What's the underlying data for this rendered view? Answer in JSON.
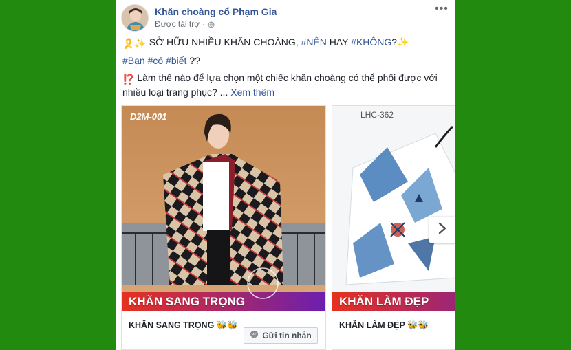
{
  "post": {
    "page_name": "Khăn choàng cổ Phạm Gia",
    "sponsored_label": "Được tài trợ",
    "separator": "·",
    "more_label": "•••",
    "text": {
      "line1_emoji": "🎗️✨",
      "line1_prefix": "SỞ HỮU NHIỀU KHĂN CHOÀNG,",
      "line1_hash1": "#NÊN",
      "line1_mid": "HAY",
      "line1_hash2": "#KHÔNG",
      "line1_suffix": "?✨",
      "line2_hash1": "#Bạn",
      "line2_hash2": "#có",
      "line2_hash3": "#biết",
      "line2_suffix": "??",
      "line3_emoji": "⁉️",
      "line3_text": "Làm thế nào để lựa chọn một chiếc khăn choàng có thể phối được với",
      "line4_text": "nhiều loại trang phục? ...",
      "see_more": "Xem thêm"
    }
  },
  "carousel": {
    "cards": [
      {
        "code": "D2M-001",
        "banner": "KHĂN SANG TRỌNG",
        "title": "KHĂN SANG TRỌNG 🐝🐝",
        "button": "Gửi tin nhắn"
      },
      {
        "code": "LHC-362",
        "banner": "KHĂN LÀM ĐẸP",
        "title": "KHĂN LÀM ĐẸP 🐝🐝"
      }
    ],
    "next_icon": "chevron-right-icon"
  },
  "colors": {
    "background": "#228b0f",
    "link": "#365899",
    "banner_start": "#e6311f",
    "banner_end": "#6a1fb0"
  }
}
